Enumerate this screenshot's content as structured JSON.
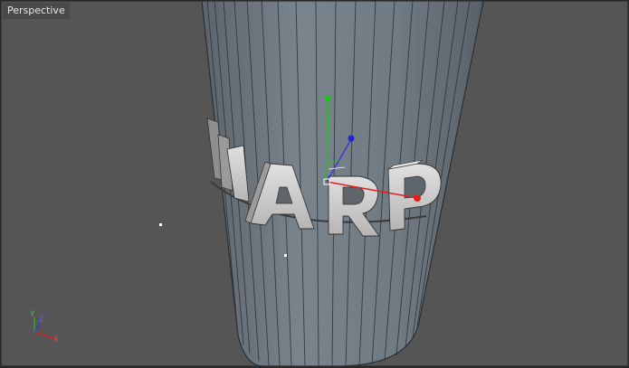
{
  "viewport": {
    "label": "Perspective"
  },
  "text_object": {
    "text": "WARP",
    "letters": [
      "W",
      "A",
      "R",
      "P"
    ]
  },
  "axis_indicator": {
    "y": "Y",
    "z": "Z",
    "x": "X"
  },
  "colors": {
    "background": "#555555",
    "cylinder_fill": "#6f7880",
    "cylinder_lines": "#2a2f33",
    "letter_face": "#c8c8c8",
    "axis_x": "#e02020",
    "axis_y": "#20c020",
    "axis_z": "#2020d0"
  }
}
